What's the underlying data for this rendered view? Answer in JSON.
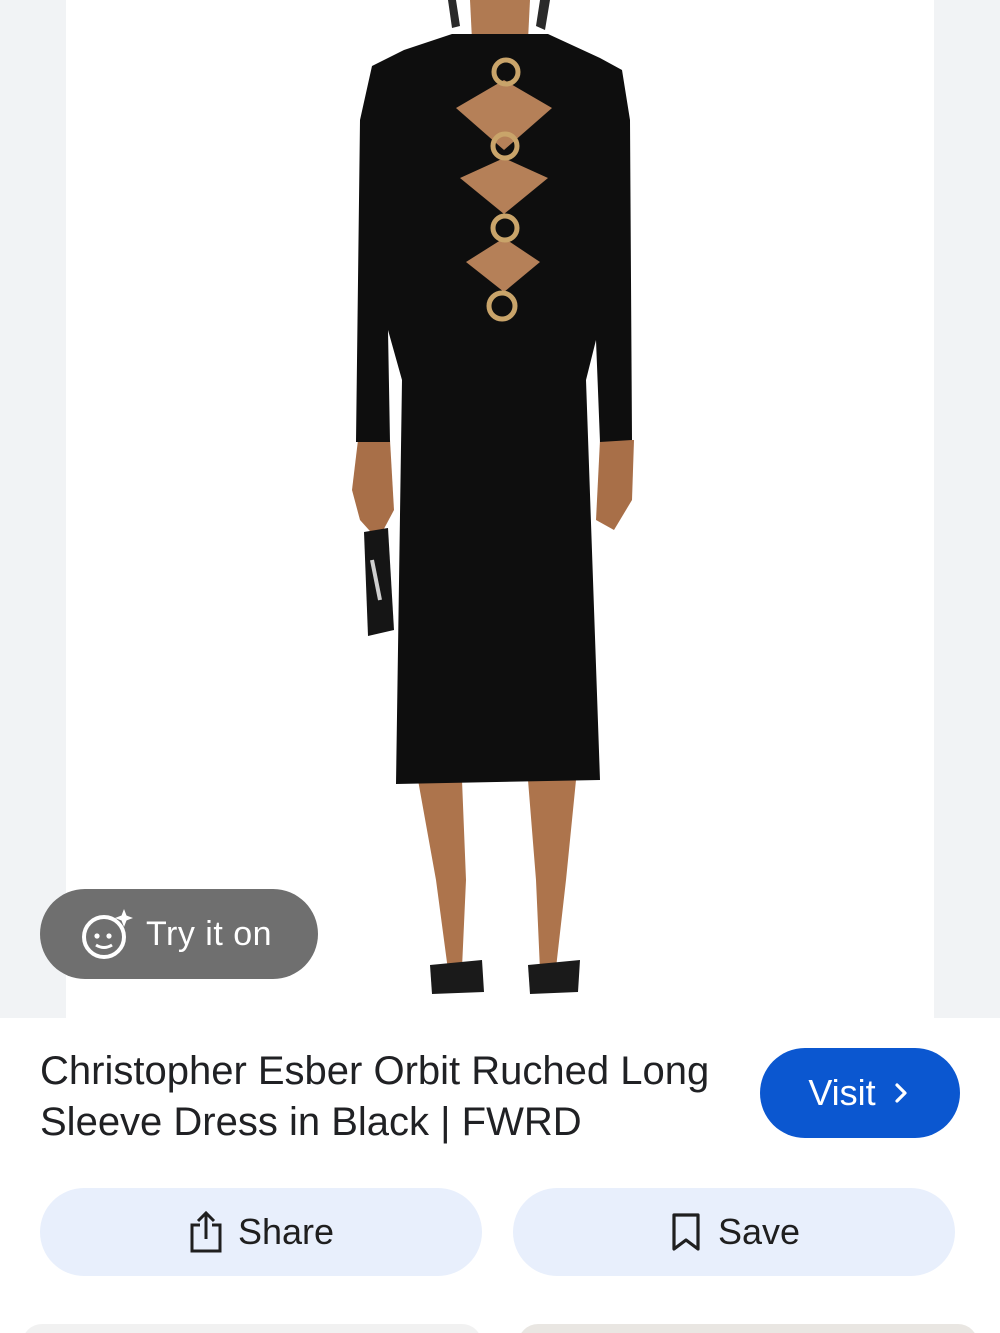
{
  "product": {
    "title": "Christopher Esber Orbit Ruched Long Sleeve Dress in Black | FWRD",
    "image_icon": "product-photo"
  },
  "try_on": {
    "label": "Try it on",
    "icon": "face-sparkle-icon"
  },
  "visit": {
    "label": "Visit",
    "icon": "chevron-right-icon",
    "color": "#0b57d0"
  },
  "actions": {
    "share": {
      "label": "Share",
      "icon": "share-icon"
    },
    "save": {
      "label": "Save",
      "icon": "bookmark-icon"
    },
    "pill_color": "#e8effc"
  }
}
